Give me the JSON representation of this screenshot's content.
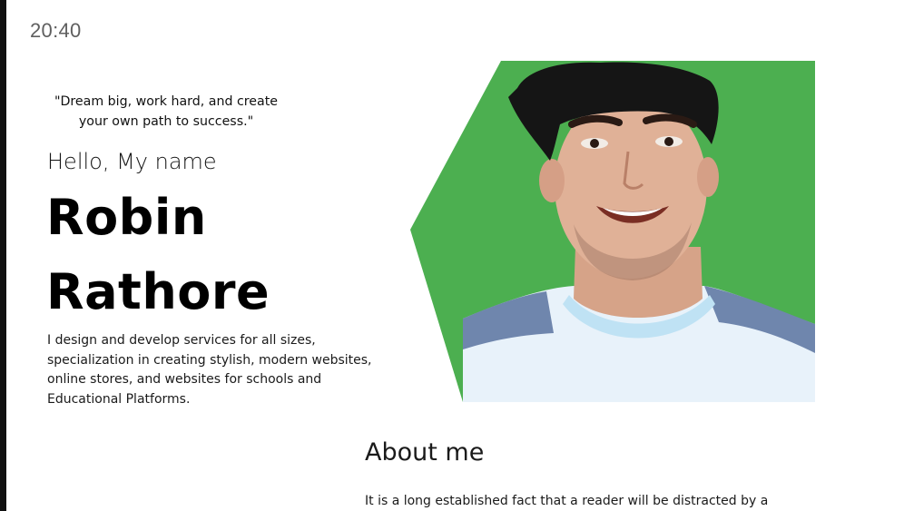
{
  "status_bar": {
    "time": "20:40"
  },
  "hero": {
    "quote": "\"Dream big, work hard, and create your own path to success.\"",
    "greeting": "Hello, My name",
    "first_name": "Robin",
    "last_name": "Rathore",
    "intro": "I design and develop services for all sizes, specialization in creating stylish, modern websites, online stores, and websites for schools and Educational Platforms."
  },
  "about": {
    "title": "About me",
    "text": "It is a long established fact that a reader will be distracted by a"
  },
  "colors": {
    "accent": "#4caf50",
    "background": "#ffffff",
    "text": "#111111"
  }
}
